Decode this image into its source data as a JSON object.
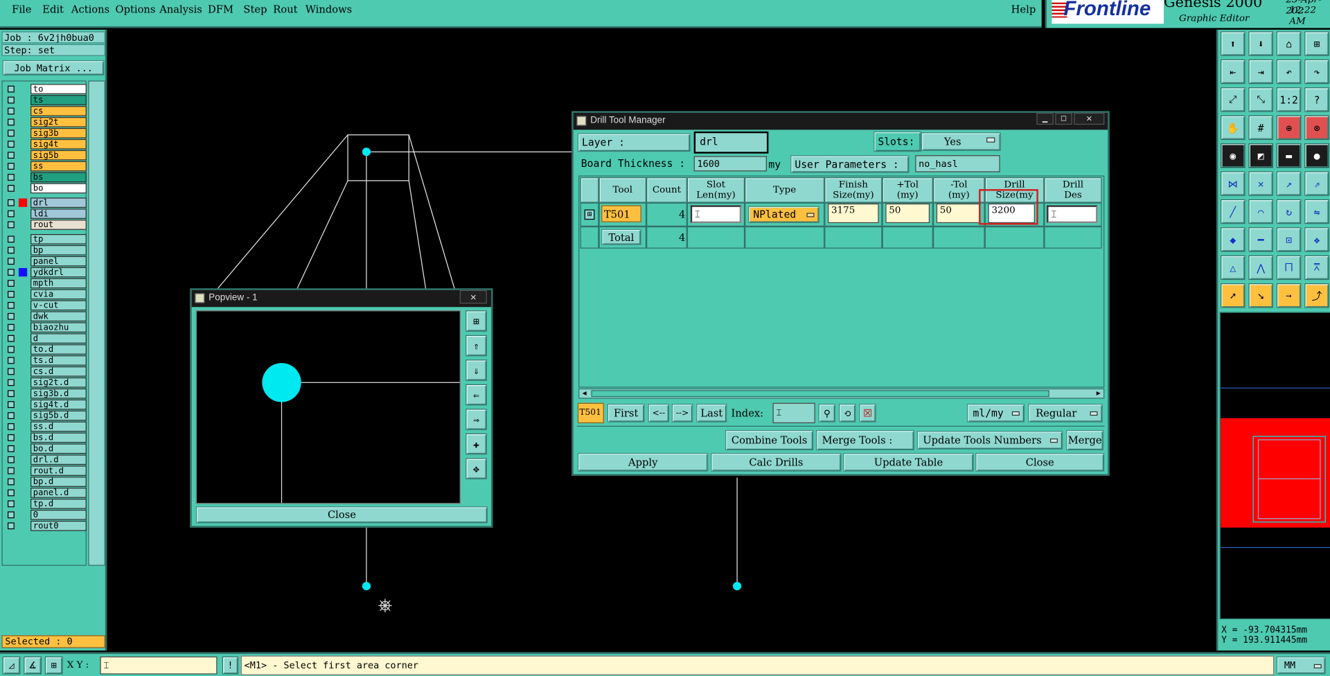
{
  "menu": [
    "File",
    "Edit",
    "Actions",
    "Options",
    "Analysis",
    "DFM",
    "Step",
    "Rout",
    "Windows"
  ],
  "help": "Help",
  "brand": {
    "logo": "Frontline",
    "product": "Genesis 2000",
    "subtitle": "Graphic Editor",
    "date": "23-Apr-202",
    "time": "12:22 AM"
  },
  "job": {
    "job_line": "Job : 6v2jh0bua0",
    "step_line": "Step: set",
    "matrix_button": "Job Matrix ..."
  },
  "layers_top": [
    {
      "name": "to",
      "color": "#ffffff"
    },
    {
      "name": "ts",
      "color": "#20a080"
    },
    {
      "name": "cs",
      "color": "#ffc040"
    },
    {
      "name": "sig2t",
      "color": "#ffc040"
    },
    {
      "name": "sig3b",
      "color": "#ffc040"
    },
    {
      "name": "sig4t",
      "color": "#ffc040"
    },
    {
      "name": "sig5b",
      "color": "#ffc040"
    },
    {
      "name": "ss",
      "color": "#ffc040"
    },
    {
      "name": "bs",
      "color": "#20a080"
    },
    {
      "name": "bo",
      "color": "#ffffff"
    }
  ],
  "layers_drill": [
    {
      "name": "drl",
      "color": "#a0c8d8"
    },
    {
      "name": "ldi",
      "color": "#a0c8d8"
    },
    {
      "name": "rout",
      "color": "#e8e0d0"
    }
  ],
  "layers_misc": [
    "tp",
    "bp",
    "panel",
    "ydkdrl",
    "mpth",
    "cvia",
    "v-cut",
    "dwk",
    "biaozhu",
    "d",
    "to.d",
    "ts.d",
    "cs.d",
    "sig2t.d",
    "sig3b.d",
    "sig4t.d",
    "sig5b.d",
    "ss.d",
    "bs.d",
    "bo.d",
    "drl.d",
    "rout.d",
    "bp.d",
    "panel.d",
    "tp.d",
    "0",
    "rout0"
  ],
  "selected": "Selected : 0",
  "popview": {
    "title": "Popview - 1",
    "close": "Close"
  },
  "dtm": {
    "title": "Drill Tool Manager",
    "layer_label": "Layer        :",
    "layer_value": "drl",
    "slots_label": "Slots:",
    "slots_value": "Yes",
    "board_label": "Board Thickness :",
    "board_value": "1600",
    "board_unit": "my",
    "userparams_label": "User Parameters :",
    "userparams_value": "no_hasl",
    "columns": [
      {
        "l1": "Tool",
        "l2": ""
      },
      {
        "l1": "Count",
        "l2": ""
      },
      {
        "l1": "Slot",
        "l2": "Len(my)"
      },
      {
        "l1": "Type",
        "l2": ""
      },
      {
        "l1": "Finish",
        "l2": "Size(my)"
      },
      {
        "l1": "+Tol",
        "l2": "(my)"
      },
      {
        "l1": "-Tol",
        "l2": "(my)"
      },
      {
        "l1": "Drill",
        "l2": "Size(my"
      },
      {
        "l1": "Drill",
        "l2": "Des"
      }
    ],
    "row": {
      "tool": "T501",
      "count": "4",
      "type": "NPlated",
      "finish": "3175",
      "ptol": "50",
      "mtol": "50",
      "drill": "3200"
    },
    "total": {
      "label": "Total",
      "count": "4"
    },
    "nav": {
      "current": "T501",
      "first": "First",
      "prev": "<--",
      "next": "-->",
      "last": "Last",
      "index_label": "Index:",
      "units": "ml/my",
      "mode": "Regular"
    },
    "actions": {
      "combine": "Combine Tools",
      "merge_label": "Merge Tools :",
      "update_numbers": "Update Tools Numbers",
      "merge": "Merge"
    },
    "bottom": {
      "apply": "Apply",
      "calc": "Calc Drills",
      "update": "Update Table",
      "close": "Close"
    }
  },
  "coords": {
    "x": "X = -93.704315mm",
    "y": "Y = 193.911445mm"
  },
  "status": {
    "xy_label": "X Y :",
    "prompt": "<M1> - Select first area corner",
    "units": "MM"
  },
  "colors": {
    "panel": "#4ecab0",
    "button": "#8fd8cf",
    "field": "#fff8d0",
    "canvas": "#000000",
    "cyan": "#00e8f0",
    "red": "#ff0000",
    "highlight": "#ffc040"
  }
}
